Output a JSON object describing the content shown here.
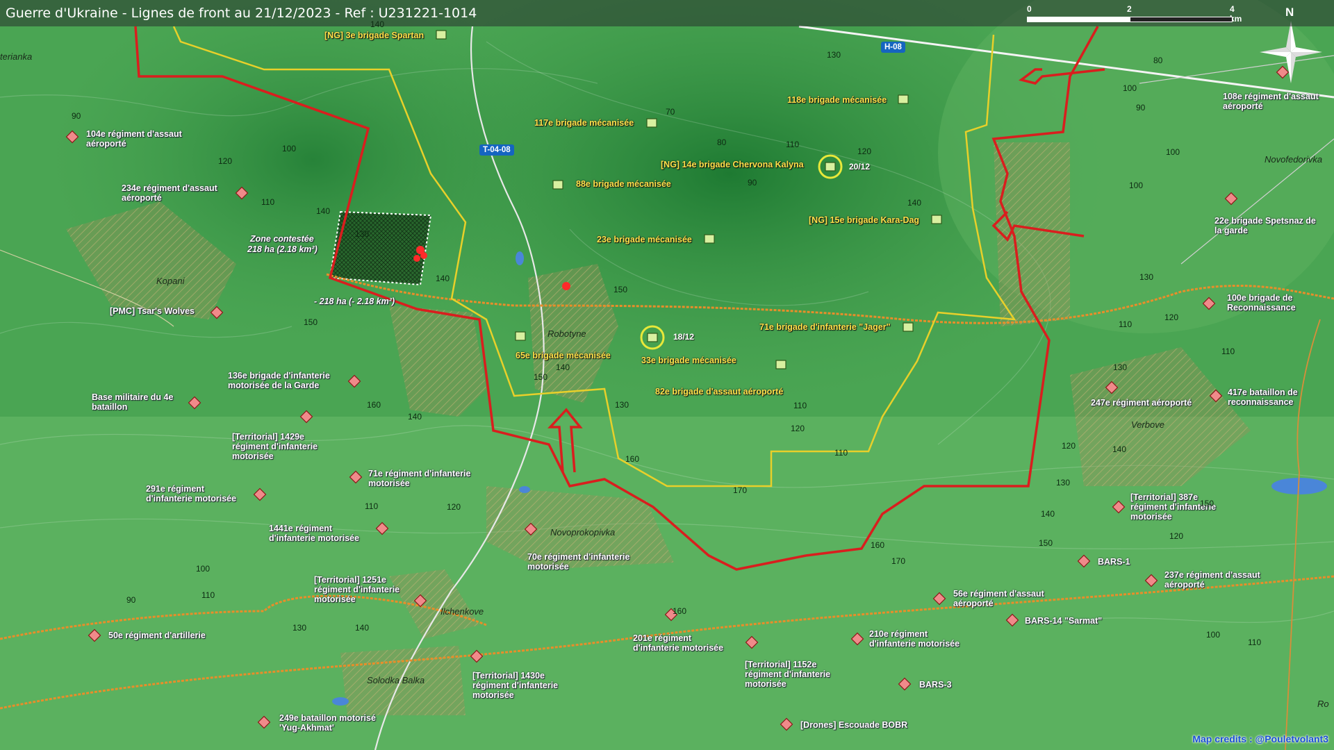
{
  "title": "Guerre d'Ukraine - Lignes de front au 21/12/2023 - Ref : U231221-1014",
  "scale": {
    "labels": [
      "0",
      "2",
      "4 km"
    ]
  },
  "compass": {
    "north": "N"
  },
  "roads": {
    "h08": "H-08",
    "t0408": "T-04-08"
  },
  "colors": {
    "background": "#3f9a4a",
    "front_red": "#d91e1e",
    "front_yellow": "#e8d02a",
    "ru_unit": "#f08a8a",
    "ua_unit": "#d8f0a0"
  },
  "places": {
    "terianka": "terianka",
    "kopani": "Kopani",
    "robotyne": "Robotyne",
    "novoprokopivka": "Novoprokopivka",
    "ilchenkove": "Ilchenkove",
    "solodka_balka": "Solodka Balka",
    "verbove": "Verbove",
    "novofedorivka": "Novofedorivka",
    "ro": "Ro"
  },
  "zone": {
    "title": "Zone contestée",
    "area": "218 ha (2.18 km²)",
    "neg_area": "- 218 ha (- 2.18 km²)"
  },
  "ua_units": {
    "spartan": "[NG] 3e brigade Spartan",
    "b117": "117e brigade mécanisée",
    "b118": "118e brigade mécanisée",
    "chervona": "[NG] 14e brigade Chervona Kalyna",
    "b88": "88e brigade mécanisée",
    "karadag": "[NG] 15e brigade Kara-Dag",
    "b23": "23e brigade mécanisée",
    "b65": "65e brigade mécanisée",
    "b33": "33e brigade mécanisée",
    "jager": "71e brigade d'infanterie \"Jager\"",
    "b82": "82e brigade d'assaut aéroporté"
  },
  "dates": {
    "d2012": "20/12",
    "d1812": "18/12"
  },
  "ru_units": {
    "r104": [
      "104e régiment d'assaut",
      "aéroporté"
    ],
    "r234": [
      "234e régiment d'assaut",
      "aéroporté"
    ],
    "tsar": [
      "[PMC] Tsar's Wolves"
    ],
    "b136": [
      "136e brigade d'infanterie",
      "motorisée de la Garde"
    ],
    "base4": [
      "Base militaire du 4e",
      "bataillon"
    ],
    "r1429": [
      "[Territorial] 1429e",
      "régiment d'infanterie",
      "motorisée"
    ],
    "r71": [
      "71e régiment d'infanterie",
      "motorisée"
    ],
    "r291": [
      "291e régiment",
      "d'infanterie motorisée"
    ],
    "r1441": [
      "1441e régiment",
      "d'infanterie motorisée"
    ],
    "r70": [
      "70e régiment d'infanterie",
      "motorisée"
    ],
    "r1251": [
      "[Territorial] 1251e",
      "régiment d'infanterie",
      "motorisée"
    ],
    "r50": [
      "50e régiment d'artillerie"
    ],
    "r201": [
      "201e régiment",
      "d'infanterie motorisée"
    ],
    "r1430": [
      "[Territorial] 1430e",
      "régiment d'infanterie",
      "motorisée"
    ],
    "r1152": [
      "[Territorial] 1152e",
      "régiment d'infanterie",
      "motorisée"
    ],
    "r210": [
      "210e régiment",
      "d'infanterie motorisée"
    ],
    "r249": [
      "249e bataillon motorisé",
      "'Yug-Akhmat'"
    ],
    "bobr": [
      "[Drones] Escouade BOBR"
    ],
    "bars3": [
      "BARS-3"
    ],
    "r56": [
      "56e régiment d'assaut",
      "aéroporté"
    ],
    "bars14": [
      "BARS-14 \"Sarmat\""
    ],
    "bars1": [
      "BARS-1"
    ],
    "r237": [
      "237e régiment d'assaut",
      "aéroporté"
    ],
    "r387": [
      "[Territorial] 387e",
      "régiment d'infanterie",
      "motorisée"
    ],
    "r247": [
      "247e régiment aéroporté"
    ],
    "b417": [
      "417e bataillon de",
      "reconnaissance"
    ],
    "b100": [
      "100e brigade de",
      "Reconnaissance"
    ],
    "b22": [
      "22e brigade Spetsnaz de",
      "la garde"
    ],
    "r108": [
      "108e régiment d'assaut",
      "aéroporté"
    ]
  },
  "contours": [
    "140",
    "130",
    "80",
    "90",
    "100",
    "110",
    "120",
    "140",
    "130",
    "140",
    "150",
    "160",
    "140",
    "150",
    "120",
    "110",
    "100",
    "90",
    "110",
    "130",
    "140",
    "160",
    "160",
    "170",
    "150",
    "140",
    "130",
    "120",
    "110",
    "100",
    "100",
    "90",
    "100",
    "70",
    "80",
    "90",
    "110",
    "120",
    "140",
    "130",
    "120",
    "110",
    "150",
    "140",
    "130",
    "160",
    "170",
    "110",
    "120",
    "110",
    "130",
    "140",
    "150",
    "120",
    "100",
    "110"
  ],
  "credit": "Map credits : @Pouletvolant3"
}
